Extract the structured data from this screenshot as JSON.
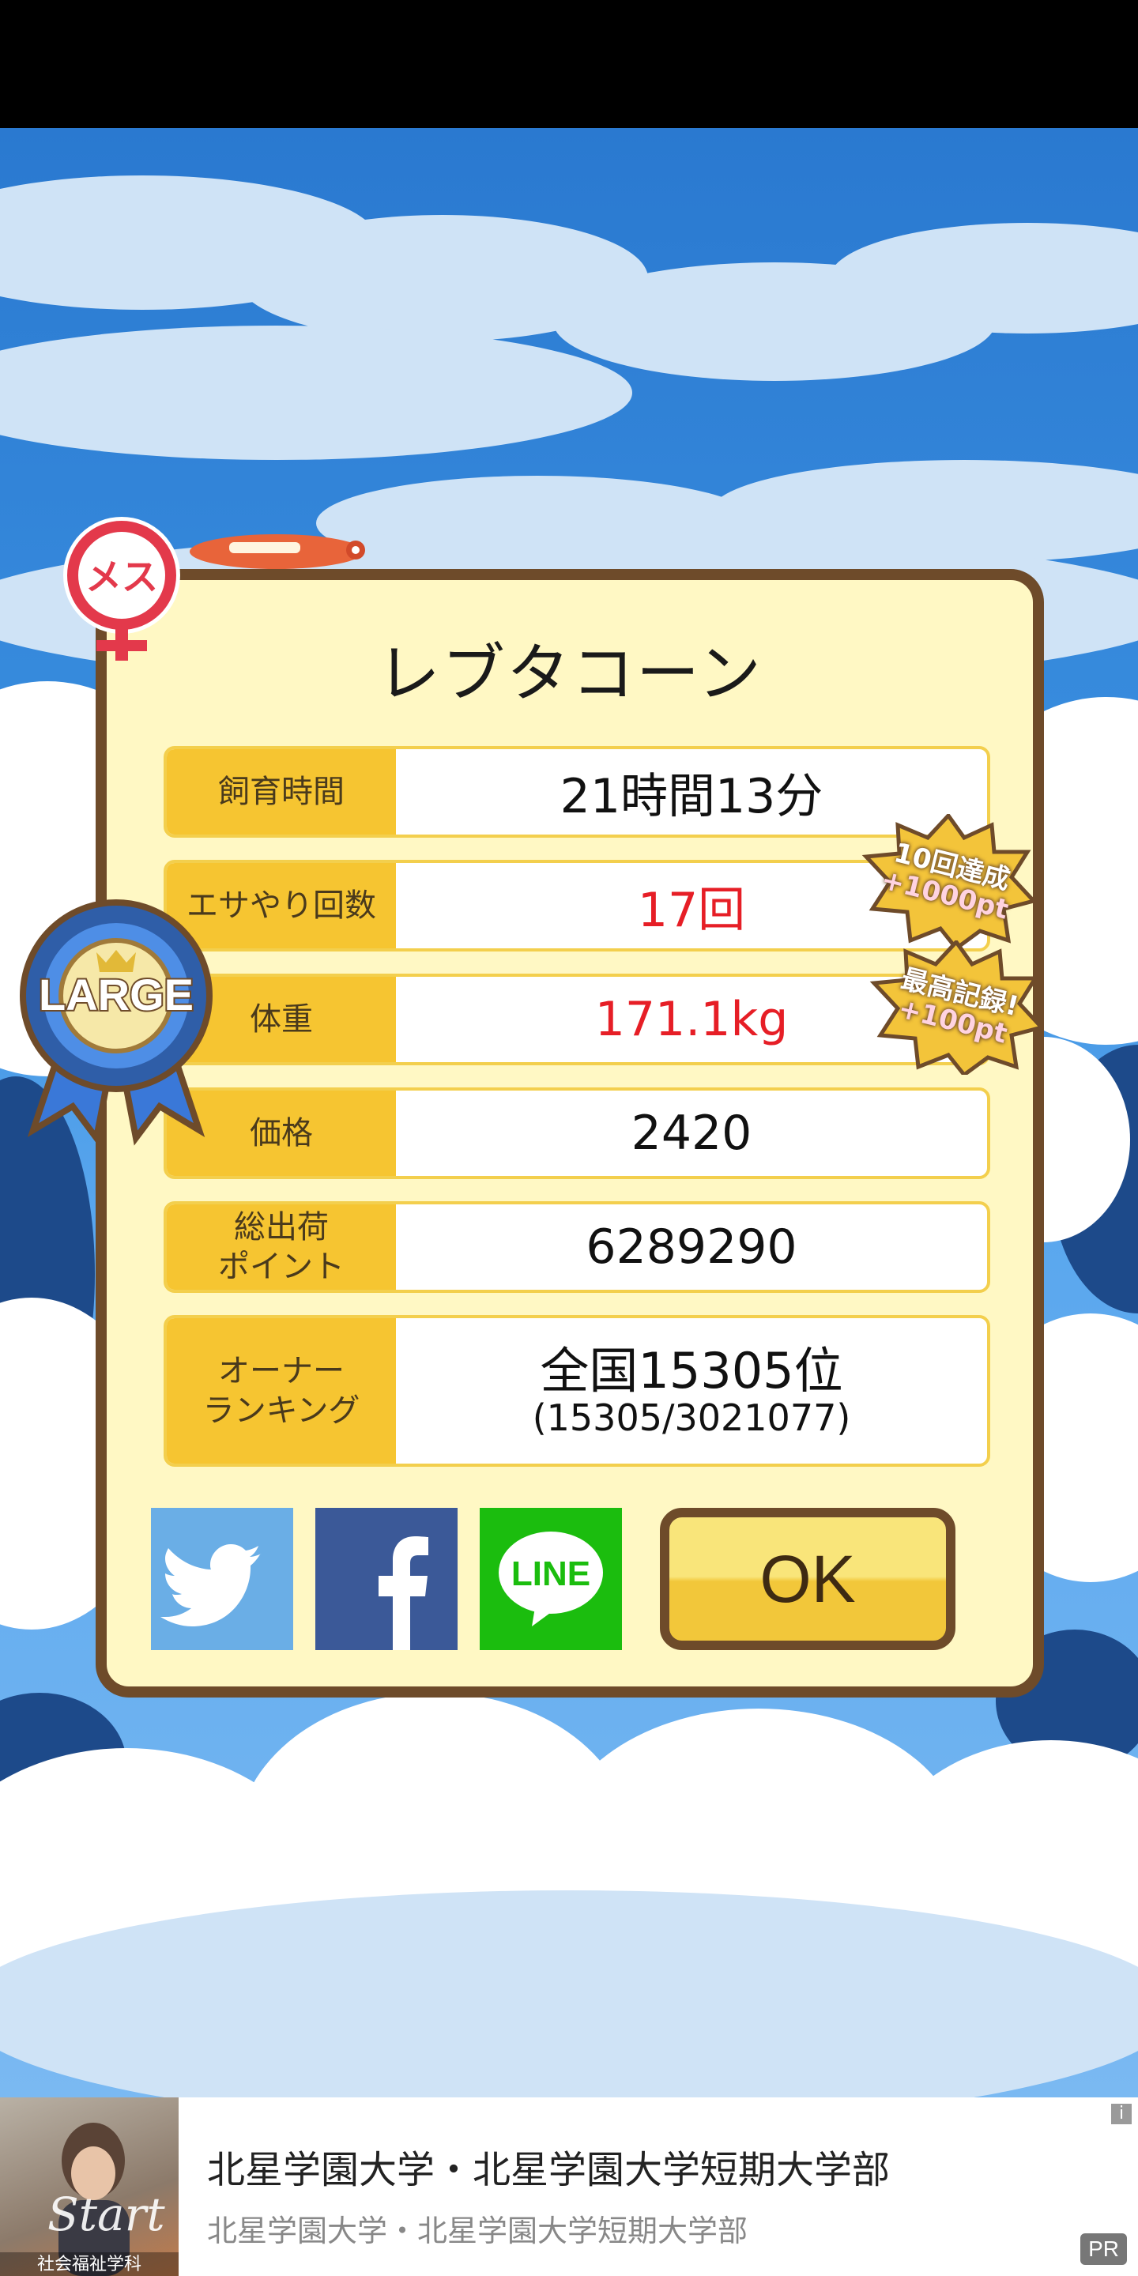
{
  "dialog": {
    "title": "レブタコーン",
    "gender_badge": "メス",
    "size_badge": "LARGE",
    "rows": [
      {
        "label": "飼育時間",
        "value": "21時間13分"
      },
      {
        "label": "エサやり回数",
        "value": "17回"
      },
      {
        "label": "体重",
        "value": "171.1kg"
      },
      {
        "label": "価格",
        "value": "2420"
      },
      {
        "label": "総出荷\nポイント",
        "value": "6289290"
      },
      {
        "label": "オーナー\nランキング",
        "value": "全国15305位",
        "sub_value": "(15305/3021077)"
      }
    ],
    "bonuses": [
      {
        "line1": "10回達成",
        "line2": "+1000pt"
      },
      {
        "line1": "最高記録!",
        "line2": "+100pt"
      }
    ],
    "share": {
      "line_label": "LINE"
    },
    "ok_label": "OK"
  },
  "ad": {
    "title": "北星学園大学・北星学園大学短期大学部",
    "subtitle": "北星学園大学・北星学園大学短期大学部",
    "image_text": "Start",
    "image_caption": "社会福祉学科",
    "pr_label": "PR",
    "info_label": "i"
  },
  "colors": {
    "twitter": "#6aaee6",
    "facebook": "#3b5998",
    "line": "#1bbd0e",
    "highlight_red": "#e61e26"
  }
}
